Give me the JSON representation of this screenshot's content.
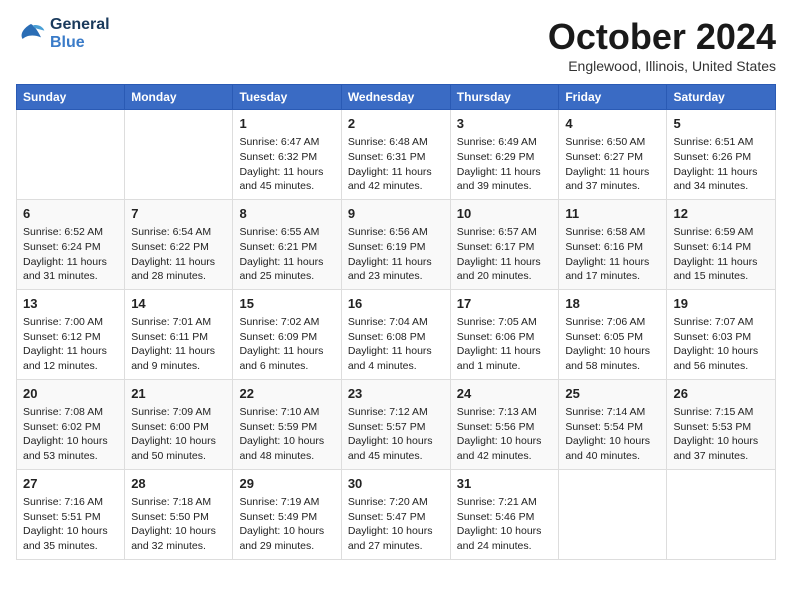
{
  "header": {
    "logo_line1": "General",
    "logo_line2": "Blue",
    "month": "October 2024",
    "location": "Englewood, Illinois, United States"
  },
  "weekdays": [
    "Sunday",
    "Monday",
    "Tuesday",
    "Wednesday",
    "Thursday",
    "Friday",
    "Saturday"
  ],
  "weeks": [
    [
      {
        "day": "",
        "info": ""
      },
      {
        "day": "",
        "info": ""
      },
      {
        "day": "1",
        "info": "Sunrise: 6:47 AM\nSunset: 6:32 PM\nDaylight: 11 hours and 45 minutes."
      },
      {
        "day": "2",
        "info": "Sunrise: 6:48 AM\nSunset: 6:31 PM\nDaylight: 11 hours and 42 minutes."
      },
      {
        "day": "3",
        "info": "Sunrise: 6:49 AM\nSunset: 6:29 PM\nDaylight: 11 hours and 39 minutes."
      },
      {
        "day": "4",
        "info": "Sunrise: 6:50 AM\nSunset: 6:27 PM\nDaylight: 11 hours and 37 minutes."
      },
      {
        "day": "5",
        "info": "Sunrise: 6:51 AM\nSunset: 6:26 PM\nDaylight: 11 hours and 34 minutes."
      }
    ],
    [
      {
        "day": "6",
        "info": "Sunrise: 6:52 AM\nSunset: 6:24 PM\nDaylight: 11 hours and 31 minutes."
      },
      {
        "day": "7",
        "info": "Sunrise: 6:54 AM\nSunset: 6:22 PM\nDaylight: 11 hours and 28 minutes."
      },
      {
        "day": "8",
        "info": "Sunrise: 6:55 AM\nSunset: 6:21 PM\nDaylight: 11 hours and 25 minutes."
      },
      {
        "day": "9",
        "info": "Sunrise: 6:56 AM\nSunset: 6:19 PM\nDaylight: 11 hours and 23 minutes."
      },
      {
        "day": "10",
        "info": "Sunrise: 6:57 AM\nSunset: 6:17 PM\nDaylight: 11 hours and 20 minutes."
      },
      {
        "day": "11",
        "info": "Sunrise: 6:58 AM\nSunset: 6:16 PM\nDaylight: 11 hours and 17 minutes."
      },
      {
        "day": "12",
        "info": "Sunrise: 6:59 AM\nSunset: 6:14 PM\nDaylight: 11 hours and 15 minutes."
      }
    ],
    [
      {
        "day": "13",
        "info": "Sunrise: 7:00 AM\nSunset: 6:12 PM\nDaylight: 11 hours and 12 minutes."
      },
      {
        "day": "14",
        "info": "Sunrise: 7:01 AM\nSunset: 6:11 PM\nDaylight: 11 hours and 9 minutes."
      },
      {
        "day": "15",
        "info": "Sunrise: 7:02 AM\nSunset: 6:09 PM\nDaylight: 11 hours and 6 minutes."
      },
      {
        "day": "16",
        "info": "Sunrise: 7:04 AM\nSunset: 6:08 PM\nDaylight: 11 hours and 4 minutes."
      },
      {
        "day": "17",
        "info": "Sunrise: 7:05 AM\nSunset: 6:06 PM\nDaylight: 11 hours and 1 minute."
      },
      {
        "day": "18",
        "info": "Sunrise: 7:06 AM\nSunset: 6:05 PM\nDaylight: 10 hours and 58 minutes."
      },
      {
        "day": "19",
        "info": "Sunrise: 7:07 AM\nSunset: 6:03 PM\nDaylight: 10 hours and 56 minutes."
      }
    ],
    [
      {
        "day": "20",
        "info": "Sunrise: 7:08 AM\nSunset: 6:02 PM\nDaylight: 10 hours and 53 minutes."
      },
      {
        "day": "21",
        "info": "Sunrise: 7:09 AM\nSunset: 6:00 PM\nDaylight: 10 hours and 50 minutes."
      },
      {
        "day": "22",
        "info": "Sunrise: 7:10 AM\nSunset: 5:59 PM\nDaylight: 10 hours and 48 minutes."
      },
      {
        "day": "23",
        "info": "Sunrise: 7:12 AM\nSunset: 5:57 PM\nDaylight: 10 hours and 45 minutes."
      },
      {
        "day": "24",
        "info": "Sunrise: 7:13 AM\nSunset: 5:56 PM\nDaylight: 10 hours and 42 minutes."
      },
      {
        "day": "25",
        "info": "Sunrise: 7:14 AM\nSunset: 5:54 PM\nDaylight: 10 hours and 40 minutes."
      },
      {
        "day": "26",
        "info": "Sunrise: 7:15 AM\nSunset: 5:53 PM\nDaylight: 10 hours and 37 minutes."
      }
    ],
    [
      {
        "day": "27",
        "info": "Sunrise: 7:16 AM\nSunset: 5:51 PM\nDaylight: 10 hours and 35 minutes."
      },
      {
        "day": "28",
        "info": "Sunrise: 7:18 AM\nSunset: 5:50 PM\nDaylight: 10 hours and 32 minutes."
      },
      {
        "day": "29",
        "info": "Sunrise: 7:19 AM\nSunset: 5:49 PM\nDaylight: 10 hours and 29 minutes."
      },
      {
        "day": "30",
        "info": "Sunrise: 7:20 AM\nSunset: 5:47 PM\nDaylight: 10 hours and 27 minutes."
      },
      {
        "day": "31",
        "info": "Sunrise: 7:21 AM\nSunset: 5:46 PM\nDaylight: 10 hours and 24 minutes."
      },
      {
        "day": "",
        "info": ""
      },
      {
        "day": "",
        "info": ""
      }
    ]
  ]
}
